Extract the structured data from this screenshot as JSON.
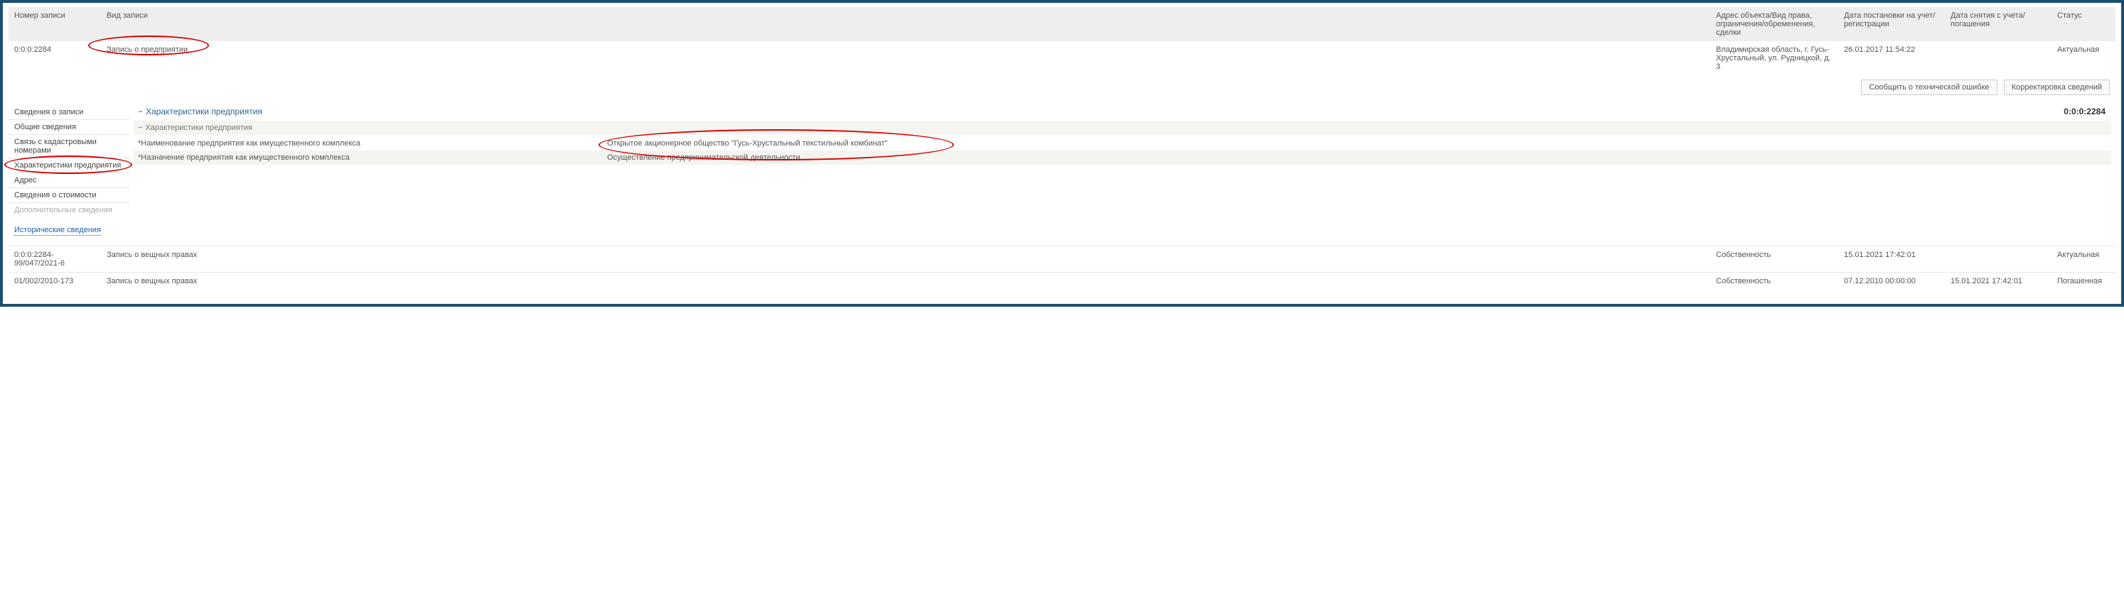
{
  "columns": {
    "c1": "Номер записи",
    "c2": "Вид записи",
    "c3": "Адрес объекта/Вид права, ограничения/обременения, сделки",
    "c4": "Дата постановки на учет/регистрации",
    "c5": "Дата снятия с учета/погашения",
    "c6": "Статус"
  },
  "rows": [
    {
      "num": "0:0:0:2284",
      "type": "Запись о предприятии",
      "addr": "Владимирская область, г. Гусь-Хрустальный, ул. Рудницкой, д. 3",
      "reg": "26.01.2017 11:54:22",
      "end": "",
      "status": "Актуальная",
      "status_kind": "active"
    },
    {
      "num": "0:0:0:2284-99/047/2021-6",
      "type": "Запись о вещных правах",
      "addr": "Собственность",
      "reg": "15.01.2021 17:42:01",
      "end": "",
      "status": "Актуальная",
      "status_kind": "active"
    },
    {
      "num": "01/002/2010-173",
      "type": "Запись о вещных правах",
      "addr": "Собственность",
      "reg": "07.12.2010 00:00:00",
      "end": "15.01.2021 17:42:01",
      "status": "Погашенная",
      "status_kind": "expired"
    }
  ],
  "actions": {
    "report": "Сообщить о технической ошибке",
    "correct": "Корректировка сведений"
  },
  "detail_header_id": "0:0:0:2284",
  "sidebar": {
    "items": [
      "Сведения о записи",
      "Общие сведения",
      "Связь с кадастровыми номерами",
      "Характеристики предприятия",
      "Адрес",
      "Сведения о стоимости",
      "Дополнительные сведения"
    ],
    "historic": "Исторические сведения"
  },
  "section": {
    "title": "Характеристики предприятия",
    "subtitle": "Характеристики предприятия",
    "kv": [
      {
        "label": "*Наименование предприятия как имущественного комплекса",
        "value": "Открытое акционерное общество \"Гусь-Хрустальный текстильный комбинат\""
      },
      {
        "label": "*Назначение предприятия как имущественного комплекса",
        "value": "Осуществление предпринимательской деятельности"
      }
    ]
  },
  "minus": "−"
}
